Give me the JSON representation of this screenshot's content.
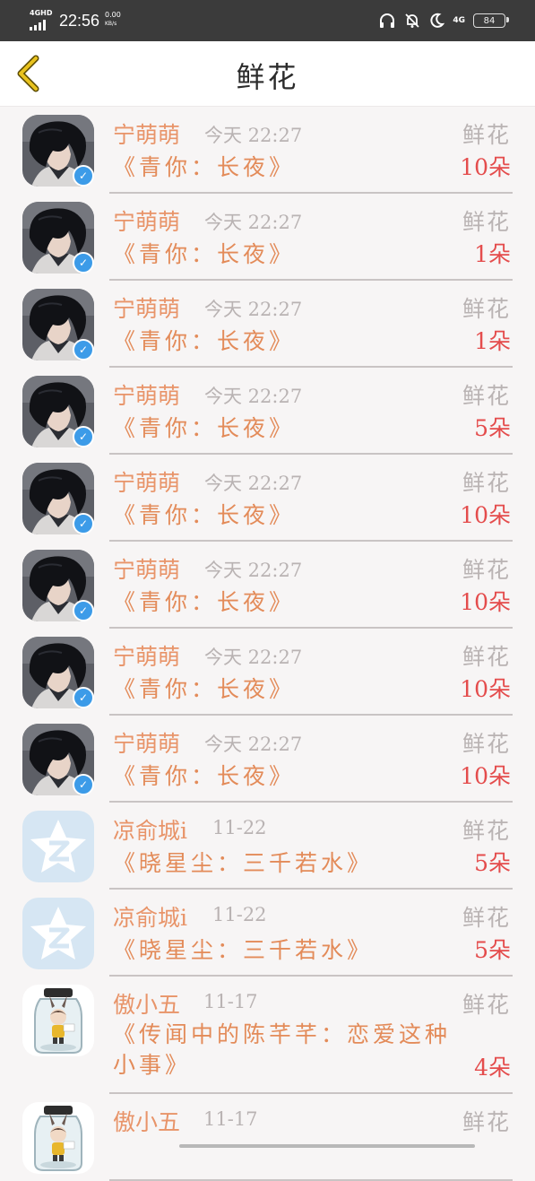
{
  "status_bar": {
    "network": "4GHD",
    "time": "22:56",
    "speed_value": "0.00",
    "speed_unit": "KB/s",
    "cell": "4G",
    "battery": "84"
  },
  "header": {
    "title": "鲜花"
  },
  "flower_label": "鲜花",
  "items": [
    {
      "name": "宁萌萌",
      "time": "今天 22:27",
      "book": "《青你：长夜》",
      "count": "10朵",
      "avatar": "boy"
    },
    {
      "name": "宁萌萌",
      "time": "今天 22:27",
      "book": "《青你：长夜》",
      "count": "1朵",
      "avatar": "boy"
    },
    {
      "name": "宁萌萌",
      "time": "今天 22:27",
      "book": "《青你：长夜》",
      "count": "1朵",
      "avatar": "boy"
    },
    {
      "name": "宁萌萌",
      "time": "今天 22:27",
      "book": "《青你：长夜》",
      "count": "5朵",
      "avatar": "boy"
    },
    {
      "name": "宁萌萌",
      "time": "今天 22:27",
      "book": "《青你：长夜》",
      "count": "10朵",
      "avatar": "boy"
    },
    {
      "name": "宁萌萌",
      "time": "今天 22:27",
      "book": "《青你：长夜》",
      "count": "10朵",
      "avatar": "boy"
    },
    {
      "name": "宁萌萌",
      "time": "今天 22:27",
      "book": "《青你：长夜》",
      "count": "10朵",
      "avatar": "boy"
    },
    {
      "name": "宁萌萌",
      "time": "今天 22:27",
      "book": "《青你：长夜》",
      "count": "10朵",
      "avatar": "boy"
    },
    {
      "name": "凉俞城i",
      "time": "11-22",
      "book": "《晓星尘：三千若水》",
      "count": "5朵",
      "avatar": "qq"
    },
    {
      "name": "凉俞城i",
      "time": "11-22",
      "book": "《晓星尘：三千若水》",
      "count": "5朵",
      "avatar": "qq"
    },
    {
      "name": "傲小五",
      "time": "11-17",
      "book": "《传闻中的陈芊芊：恋爱这种小事》",
      "count": "4朵",
      "avatar": "jar"
    },
    {
      "name": "傲小五",
      "time": "11-17",
      "book": "",
      "count": "",
      "avatar": "jar"
    }
  ],
  "colors": {
    "name": "#e89469",
    "book": "#e38b59",
    "count": "#e44c4c",
    "muted": "#b9b3b3",
    "back_arrow": "#e8c21e"
  }
}
